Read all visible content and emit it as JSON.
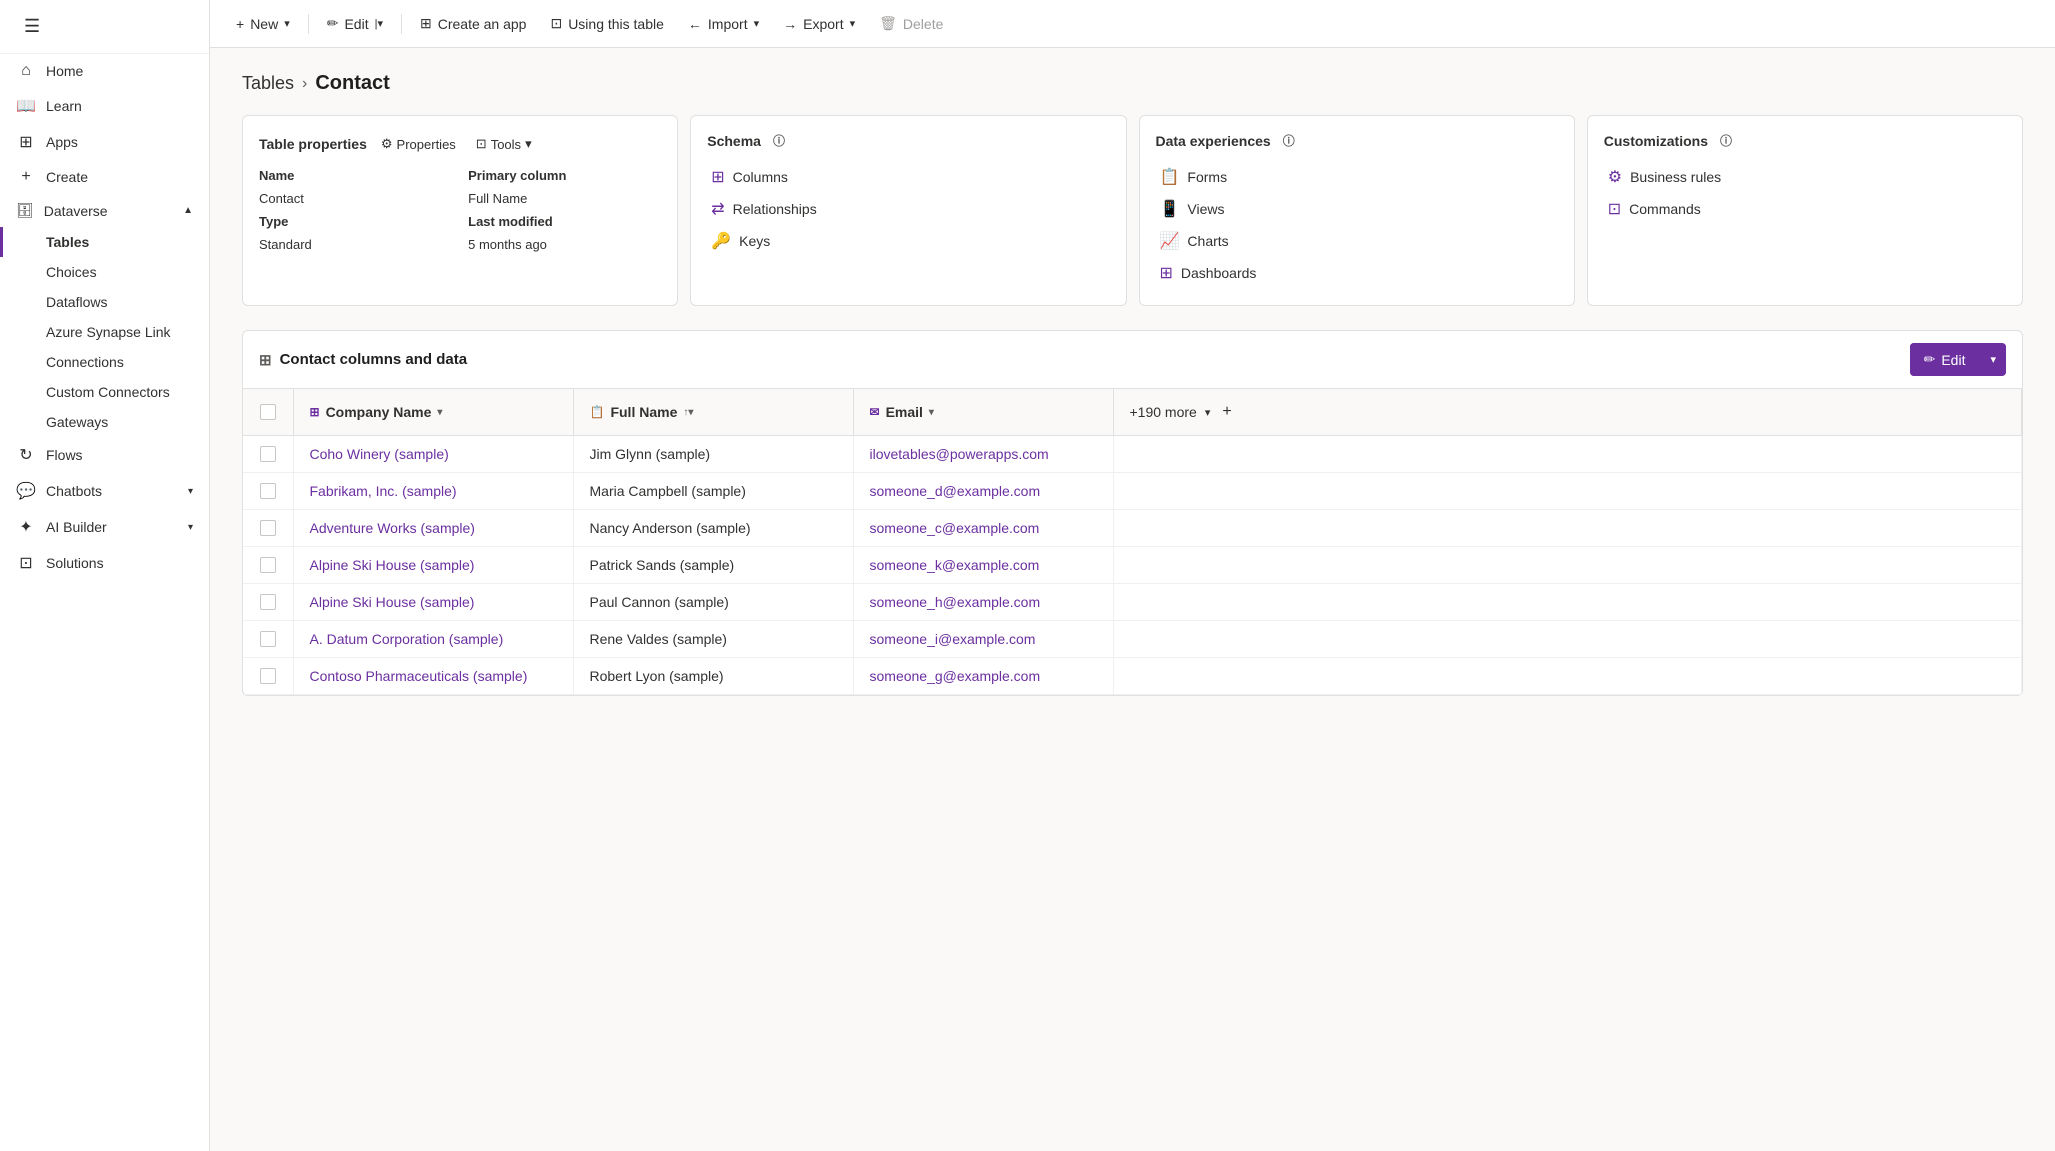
{
  "sidebar": {
    "menu_icon": "☰",
    "items": [
      {
        "id": "home",
        "label": "Home",
        "icon": "⌂",
        "active": false
      },
      {
        "id": "learn",
        "label": "Learn",
        "icon": "📖",
        "active": false
      },
      {
        "id": "apps",
        "label": "Apps",
        "icon": "⊞",
        "active": false
      },
      {
        "id": "create",
        "label": "Create",
        "icon": "+",
        "active": false
      }
    ],
    "dataverse_group": {
      "label": "Dataverse",
      "icon": "🗄",
      "expanded": true,
      "sub_items": [
        {
          "id": "tables",
          "label": "Tables",
          "active": true
        },
        {
          "id": "choices",
          "label": "Choices",
          "active": false
        },
        {
          "id": "dataflows",
          "label": "Dataflows",
          "active": false
        },
        {
          "id": "azure-synapse",
          "label": "Azure Synapse Link",
          "active": false
        },
        {
          "id": "connections",
          "label": "Connections",
          "active": false
        },
        {
          "id": "custom-connectors",
          "label": "Custom Connectors",
          "active": false
        },
        {
          "id": "gateways",
          "label": "Gateways",
          "active": false
        }
      ]
    },
    "flows": {
      "label": "Flows",
      "icon": "↻",
      "active": false
    },
    "chatbots": {
      "label": "Chatbots",
      "icon": "💬",
      "active": false,
      "has_children": true
    },
    "ai_builder": {
      "label": "AI Builder",
      "icon": "✦",
      "active": false,
      "has_children": true
    },
    "solutions": {
      "label": "Solutions",
      "icon": "⊡",
      "active": false
    }
  },
  "toolbar": {
    "new_label": "New",
    "edit_label": "Edit",
    "create_app_label": "Create an app",
    "using_table_label": "Using this table",
    "import_label": "Import",
    "export_label": "Export",
    "delete_label": "Delete"
  },
  "breadcrumb": {
    "parent_label": "Tables",
    "separator": ">",
    "current_label": "Contact"
  },
  "table_properties_card": {
    "title": "Table properties",
    "properties_label": "Properties",
    "tools_label": "Tools",
    "name_label": "Name",
    "name_value": "Contact",
    "type_label": "Type",
    "type_value": "Standard",
    "primary_column_label": "Primary column",
    "primary_column_value": "Full Name",
    "last_modified_label": "Last modified",
    "last_modified_value": "5 months ago"
  },
  "schema_card": {
    "title": "Schema",
    "links": [
      {
        "id": "columns",
        "label": "Columns",
        "icon": "⊞"
      },
      {
        "id": "relationships",
        "label": "Relationships",
        "icon": "⇄"
      },
      {
        "id": "keys",
        "label": "Keys",
        "icon": "🔑"
      }
    ]
  },
  "data_experiences_card": {
    "title": "Data experiences",
    "links": [
      {
        "id": "forms",
        "label": "Forms",
        "icon": "📋"
      },
      {
        "id": "views",
        "label": "Views",
        "icon": "📱"
      },
      {
        "id": "charts",
        "label": "Charts",
        "icon": "📈"
      },
      {
        "id": "dashboards",
        "label": "Dashboards",
        "icon": "⊞"
      }
    ]
  },
  "customizations_card": {
    "title": "Customizations",
    "links": [
      {
        "id": "business-rules",
        "label": "Business rules",
        "icon": "⚙"
      },
      {
        "id": "commands",
        "label": "Commands",
        "icon": "⊡"
      }
    ]
  },
  "data_table": {
    "section_title": "Contact columns and data",
    "edit_btn_label": "Edit",
    "columns": [
      {
        "id": "company-name",
        "label": "Company Name",
        "icon": "⊞",
        "sortable": true
      },
      {
        "id": "full-name",
        "label": "Full Name",
        "icon": "📋",
        "sortable": true,
        "sort_direction": "asc"
      },
      {
        "id": "email",
        "label": "Email",
        "icon": "✉",
        "sortable": true
      }
    ],
    "more_columns_label": "+190 more",
    "rows": [
      {
        "company": "Coho Winery (sample)",
        "full_name": "Jim Glynn (sample)",
        "email": "ilovetables@powerapps.com"
      },
      {
        "company": "Fabrikam, Inc. (sample)",
        "full_name": "Maria Campbell (sample)",
        "email": "someone_d@example.com"
      },
      {
        "company": "Adventure Works (sample)",
        "full_name": "Nancy Anderson (sample)",
        "email": "someone_c@example.com"
      },
      {
        "company": "Alpine Ski House (sample)",
        "full_name": "Patrick Sands (sample)",
        "email": "someone_k@example.com"
      },
      {
        "company": "Alpine Ski House (sample)",
        "full_name": "Paul Cannon (sample)",
        "email": "someone_h@example.com"
      },
      {
        "company": "A. Datum Corporation (sample)",
        "full_name": "Rene Valdes (sample)",
        "email": "someone_i@example.com"
      },
      {
        "company": "Contoso Pharmaceuticals (sample)",
        "full_name": "Robert Lyon (sample)",
        "email": "someone_g@example.com"
      }
    ]
  }
}
